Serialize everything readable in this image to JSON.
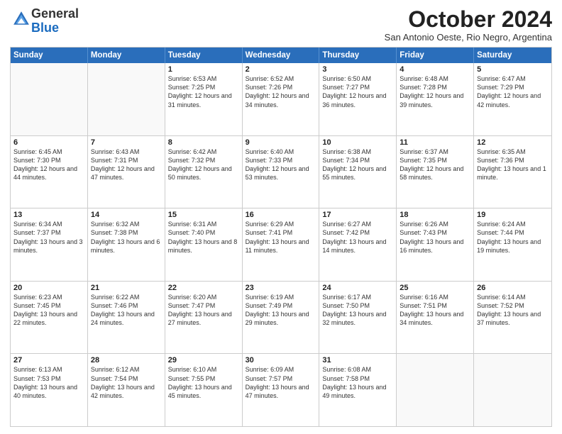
{
  "header": {
    "logo_general": "General",
    "logo_blue": "Blue",
    "month_title": "October 2024",
    "subtitle": "San Antonio Oeste, Rio Negro, Argentina"
  },
  "days_of_week": [
    "Sunday",
    "Monday",
    "Tuesday",
    "Wednesday",
    "Thursday",
    "Friday",
    "Saturday"
  ],
  "weeks": [
    [
      {
        "day": "",
        "info": ""
      },
      {
        "day": "",
        "info": ""
      },
      {
        "day": "1",
        "info": "Sunrise: 6:53 AM\nSunset: 7:25 PM\nDaylight: 12 hours and 31 minutes."
      },
      {
        "day": "2",
        "info": "Sunrise: 6:52 AM\nSunset: 7:26 PM\nDaylight: 12 hours and 34 minutes."
      },
      {
        "day": "3",
        "info": "Sunrise: 6:50 AM\nSunset: 7:27 PM\nDaylight: 12 hours and 36 minutes."
      },
      {
        "day": "4",
        "info": "Sunrise: 6:48 AM\nSunset: 7:28 PM\nDaylight: 12 hours and 39 minutes."
      },
      {
        "day": "5",
        "info": "Sunrise: 6:47 AM\nSunset: 7:29 PM\nDaylight: 12 hours and 42 minutes."
      }
    ],
    [
      {
        "day": "6",
        "info": "Sunrise: 6:45 AM\nSunset: 7:30 PM\nDaylight: 12 hours and 44 minutes."
      },
      {
        "day": "7",
        "info": "Sunrise: 6:43 AM\nSunset: 7:31 PM\nDaylight: 12 hours and 47 minutes."
      },
      {
        "day": "8",
        "info": "Sunrise: 6:42 AM\nSunset: 7:32 PM\nDaylight: 12 hours and 50 minutes."
      },
      {
        "day": "9",
        "info": "Sunrise: 6:40 AM\nSunset: 7:33 PM\nDaylight: 12 hours and 53 minutes."
      },
      {
        "day": "10",
        "info": "Sunrise: 6:38 AM\nSunset: 7:34 PM\nDaylight: 12 hours and 55 minutes."
      },
      {
        "day": "11",
        "info": "Sunrise: 6:37 AM\nSunset: 7:35 PM\nDaylight: 12 hours and 58 minutes."
      },
      {
        "day": "12",
        "info": "Sunrise: 6:35 AM\nSunset: 7:36 PM\nDaylight: 13 hours and 1 minute."
      }
    ],
    [
      {
        "day": "13",
        "info": "Sunrise: 6:34 AM\nSunset: 7:37 PM\nDaylight: 13 hours and 3 minutes."
      },
      {
        "day": "14",
        "info": "Sunrise: 6:32 AM\nSunset: 7:38 PM\nDaylight: 13 hours and 6 minutes."
      },
      {
        "day": "15",
        "info": "Sunrise: 6:31 AM\nSunset: 7:40 PM\nDaylight: 13 hours and 8 minutes."
      },
      {
        "day": "16",
        "info": "Sunrise: 6:29 AM\nSunset: 7:41 PM\nDaylight: 13 hours and 11 minutes."
      },
      {
        "day": "17",
        "info": "Sunrise: 6:27 AM\nSunset: 7:42 PM\nDaylight: 13 hours and 14 minutes."
      },
      {
        "day": "18",
        "info": "Sunrise: 6:26 AM\nSunset: 7:43 PM\nDaylight: 13 hours and 16 minutes."
      },
      {
        "day": "19",
        "info": "Sunrise: 6:24 AM\nSunset: 7:44 PM\nDaylight: 13 hours and 19 minutes."
      }
    ],
    [
      {
        "day": "20",
        "info": "Sunrise: 6:23 AM\nSunset: 7:45 PM\nDaylight: 13 hours and 22 minutes."
      },
      {
        "day": "21",
        "info": "Sunrise: 6:22 AM\nSunset: 7:46 PM\nDaylight: 13 hours and 24 minutes."
      },
      {
        "day": "22",
        "info": "Sunrise: 6:20 AM\nSunset: 7:47 PM\nDaylight: 13 hours and 27 minutes."
      },
      {
        "day": "23",
        "info": "Sunrise: 6:19 AM\nSunset: 7:49 PM\nDaylight: 13 hours and 29 minutes."
      },
      {
        "day": "24",
        "info": "Sunrise: 6:17 AM\nSunset: 7:50 PM\nDaylight: 13 hours and 32 minutes."
      },
      {
        "day": "25",
        "info": "Sunrise: 6:16 AM\nSunset: 7:51 PM\nDaylight: 13 hours and 34 minutes."
      },
      {
        "day": "26",
        "info": "Sunrise: 6:14 AM\nSunset: 7:52 PM\nDaylight: 13 hours and 37 minutes."
      }
    ],
    [
      {
        "day": "27",
        "info": "Sunrise: 6:13 AM\nSunset: 7:53 PM\nDaylight: 13 hours and 40 minutes."
      },
      {
        "day": "28",
        "info": "Sunrise: 6:12 AM\nSunset: 7:54 PM\nDaylight: 13 hours and 42 minutes."
      },
      {
        "day": "29",
        "info": "Sunrise: 6:10 AM\nSunset: 7:55 PM\nDaylight: 13 hours and 45 minutes."
      },
      {
        "day": "30",
        "info": "Sunrise: 6:09 AM\nSunset: 7:57 PM\nDaylight: 13 hours and 47 minutes."
      },
      {
        "day": "31",
        "info": "Sunrise: 6:08 AM\nSunset: 7:58 PM\nDaylight: 13 hours and 49 minutes."
      },
      {
        "day": "",
        "info": ""
      },
      {
        "day": "",
        "info": ""
      }
    ]
  ]
}
